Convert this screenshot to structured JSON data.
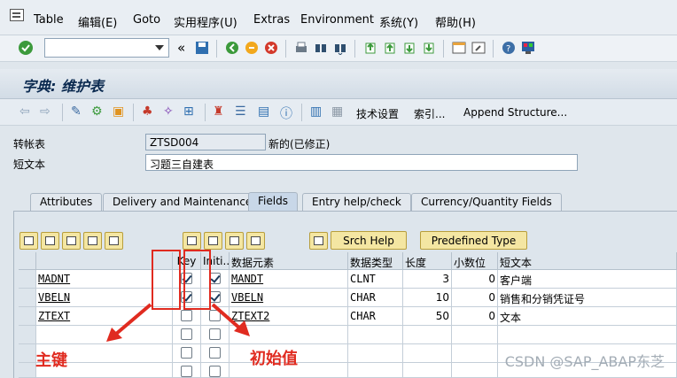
{
  "menu": {
    "items": [
      "Table",
      "编辑(E)",
      "Goto",
      "实用程序(U)",
      "Extras",
      "Environment",
      "系统(Y)",
      "帮助(H)"
    ]
  },
  "title": "字典: 维护表",
  "toolbar2": {
    "tech_settings": "技术设置",
    "index": "索引...",
    "append_structure": "Append Structure..."
  },
  "header": {
    "transparent_table_label": "转帐表",
    "table_name": "ZTSD004",
    "status": "新的(已修正)",
    "short_text_label": "短文本",
    "short_text_value": "习题三自建表"
  },
  "tabs": [
    "Attributes",
    "Delivery and Maintenance",
    "Fields",
    "Entry help/check",
    "Currency/Quantity Fields"
  ],
  "active_tab": "Fields",
  "buttons": {
    "srch_help": "Srch Help",
    "predefined_type": "Predefined Type"
  },
  "grid": {
    "columns": [
      "Key",
      "Initi...",
      "数据元素",
      "数据类型",
      "长度",
      "小数位",
      "短文本"
    ],
    "rows": [
      {
        "field": "MADNT",
        "key": true,
        "init": true,
        "element": "MANDT",
        "type": "CLNT",
        "length": "3",
        "decimals": "0",
        "text": "客户端"
      },
      {
        "field": "VBELN",
        "key": true,
        "init": true,
        "element": "VBELN",
        "type": "CHAR",
        "length": "10",
        "decimals": "0",
        "text": "销售和分销凭证号"
      },
      {
        "field": "ZTEXT",
        "key": false,
        "init": false,
        "element": "ZTEXT2",
        "type": "CHAR",
        "length": "50",
        "decimals": "0",
        "text": "文本"
      }
    ]
  },
  "annotations": {
    "primary_key": "主键",
    "initial_value": "初始值"
  },
  "watermark": "CSDN @SAP_ABAP东芝"
}
